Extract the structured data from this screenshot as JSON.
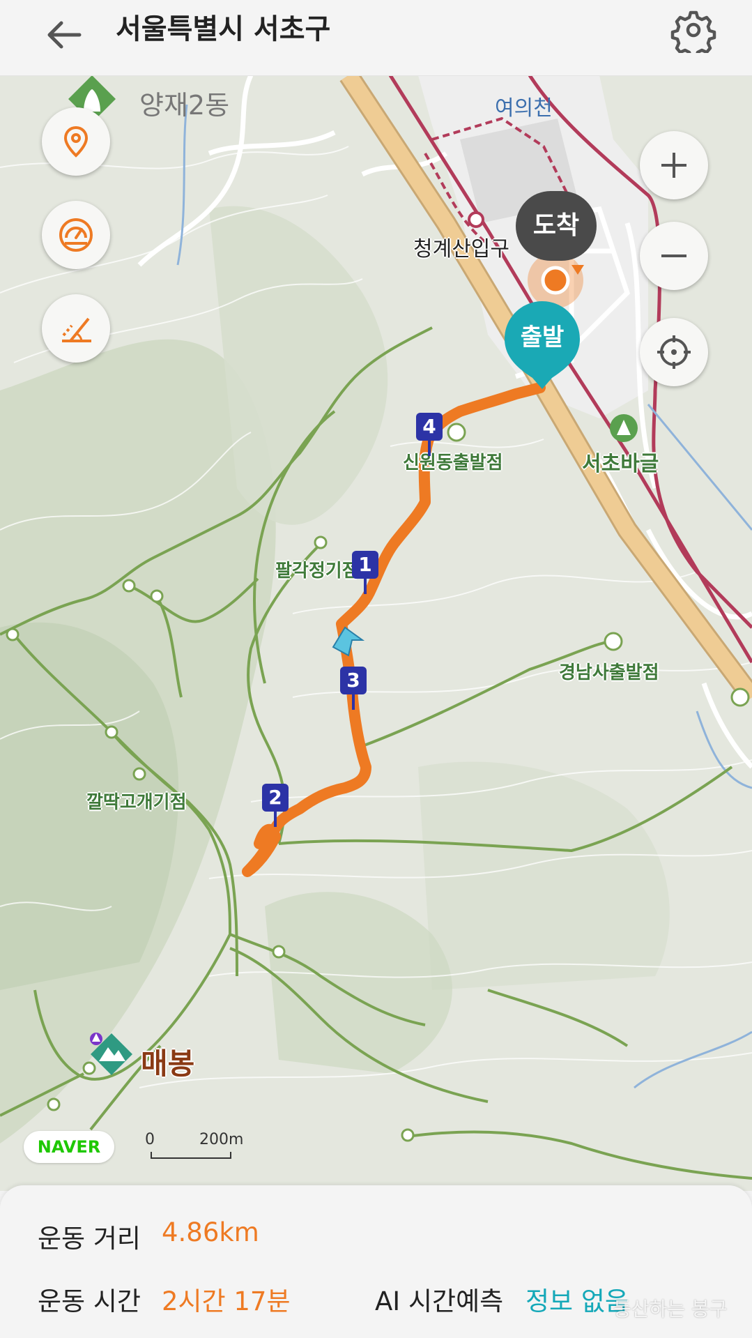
{
  "header": {
    "title": "서울특별시 서초구",
    "back_icon": "back-arrow-icon",
    "settings_icon": "gear-icon"
  },
  "map": {
    "labels": {
      "yangjae": "양재2동",
      "yeouicheon": "여의천",
      "cheonggye_entrance": "청계산입구",
      "sinwon_start": "신원동출발점",
      "seocho_camp": "서초바글",
      "palgakjeong": "팔각정기점",
      "gyeongnamsa": "경남사출발점",
      "kkalttak": "깔딱고개기점",
      "maebong": "매봉"
    },
    "markers": {
      "start": "출발",
      "end": "도착"
    },
    "waypoints": [
      "1",
      "2",
      "3",
      "4"
    ],
    "route_color": "#ee7a23",
    "logo": "NAVER",
    "scale": {
      "zero": "0",
      "distance": "200m"
    },
    "left_controls": [
      "location-pin-icon",
      "speedometer-icon",
      "elevation-icon"
    ],
    "right_controls": [
      "zoom-in-icon",
      "zoom-out-icon",
      "crosshair-icon"
    ]
  },
  "summary": {
    "distance_label": "운동 거리",
    "distance_value": "4.86km",
    "time_label": "운동 시간",
    "time_value": "2시간 17분",
    "ai_label": "AI 시간예측",
    "ai_value": "정보 없음",
    "watermark": "등산하는 봉구"
  }
}
